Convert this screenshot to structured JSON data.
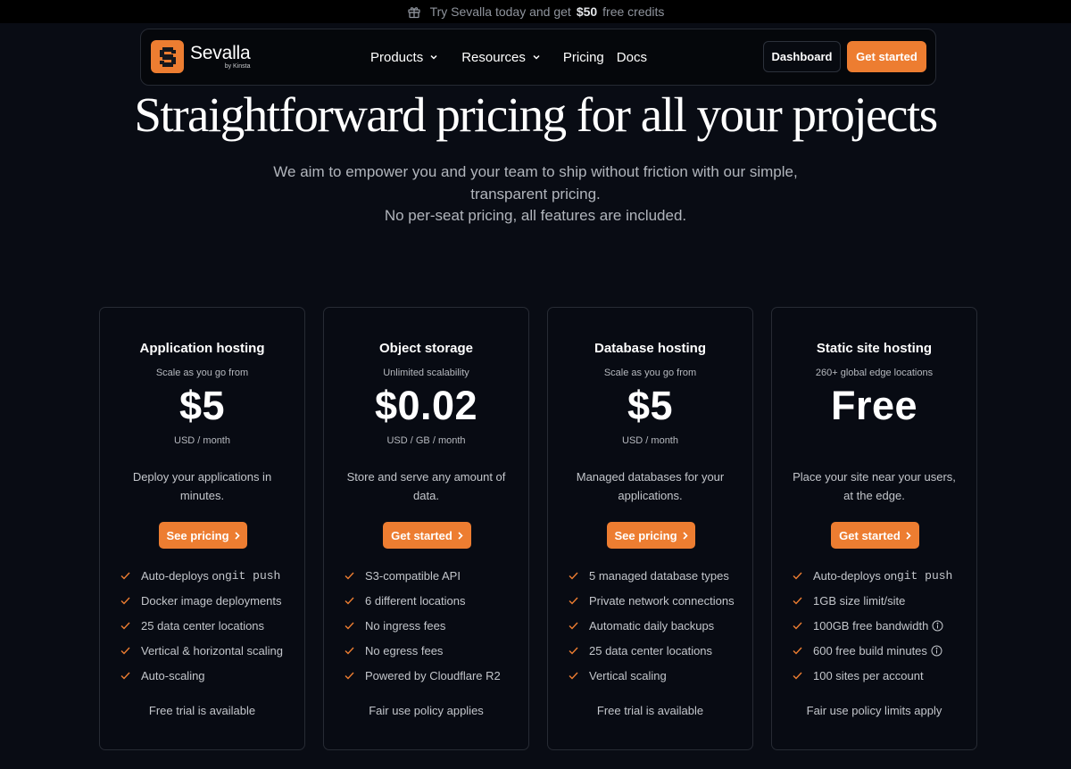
{
  "promo": {
    "icon": "gift-icon",
    "text_before": "Try Sevalla today and get",
    "amount": "$50",
    "text_after": "free credits"
  },
  "nav": {
    "brand": "Sevalla",
    "brand_by": "by Kinsta",
    "brand_color": "#ed7d31",
    "links": [
      {
        "label": "Products",
        "has_dropdown": true
      },
      {
        "label": "Resources",
        "has_dropdown": true
      },
      {
        "label": "Pricing",
        "has_dropdown": false
      },
      {
        "label": "Docs",
        "has_dropdown": false
      }
    ],
    "dashboard_label": "Dashboard",
    "get_started_label": "Get started"
  },
  "hero": {
    "title": "Straightforward pricing for all your projects",
    "subtitle_line1": "We aim to empower you and your team to ship without friction with our simple,",
    "subtitle_line2": "transparent pricing.",
    "subtitle_line3": "No per-seat pricing, all features are included."
  },
  "accent_color": "#ed7d31",
  "cards": [
    {
      "title": "Application hosting",
      "tagline": "Scale as you go from",
      "price": "$5",
      "unit": "USD / month",
      "description": "Deploy your applications in minutes.",
      "button": "See pricing",
      "features": [
        {
          "text": "Auto-deploys on ",
          "code": "git push"
        },
        {
          "text": "Docker image deployments"
        },
        {
          "text": "25 data center locations"
        },
        {
          "text": "Vertical & horizontal scaling"
        },
        {
          "text": "Auto-scaling"
        }
      ],
      "footer": "Free trial is available"
    },
    {
      "title": "Object storage",
      "tagline": "Unlimited scalability",
      "price": "$0.02",
      "unit": "USD / GB / month",
      "description": "Store and serve any amount of data.",
      "button": "Get started",
      "features": [
        {
          "text": "S3-compatible API"
        },
        {
          "text": "6 different locations"
        },
        {
          "text": "No ingress fees"
        },
        {
          "text": "No egress fees"
        },
        {
          "text": "Powered by Cloudflare R2"
        }
      ],
      "footer": "Fair use policy applies"
    },
    {
      "title": "Database hosting",
      "tagline": "Scale as you go from",
      "price": "$5",
      "unit": "USD / month",
      "description": "Managed databases for your applications.",
      "button": "See pricing",
      "features": [
        {
          "text": "5 managed database types"
        },
        {
          "text": "Private network connections"
        },
        {
          "text": "Automatic daily backups"
        },
        {
          "text": "25 data center locations"
        },
        {
          "text": "Vertical scaling"
        }
      ],
      "footer": "Free trial is available"
    },
    {
      "title": "Static site hosting",
      "tagline": "260+ global edge locations",
      "price": "Free",
      "unit": "",
      "description": "Place your site near your users, at the edge.",
      "button": "Get started",
      "features": [
        {
          "text": "Auto-deploys on ",
          "code": "git push"
        },
        {
          "text": "1GB size limit/site"
        },
        {
          "text": "100GB free bandwidth",
          "info": true
        },
        {
          "text": "600 free build minutes",
          "info": true
        },
        {
          "text": "100 sites per account"
        }
      ],
      "footer": "Fair use policy limits apply"
    }
  ]
}
